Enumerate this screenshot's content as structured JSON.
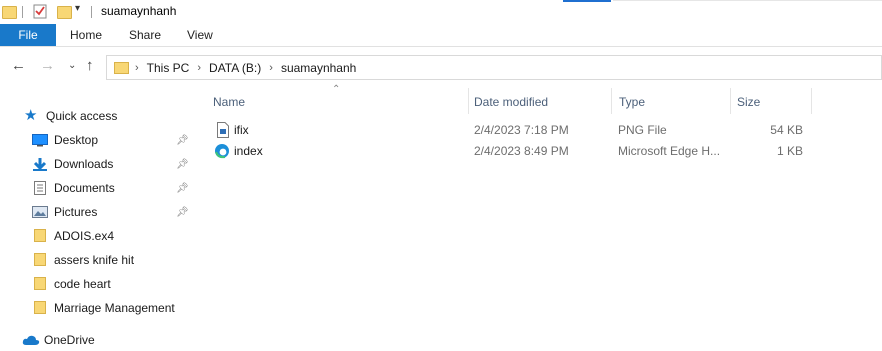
{
  "window": {
    "title": "suamaynhanh"
  },
  "ribbon": {
    "file": "File",
    "tabs": [
      "Home",
      "Share",
      "View"
    ]
  },
  "address": {
    "crumbs": [
      "This PC",
      "DATA (B:)",
      "suamaynhanh"
    ]
  },
  "nav": {
    "quick_access": "Quick access",
    "pinned": [
      {
        "label": "Desktop",
        "icon": "desktop-icon"
      },
      {
        "label": "Downloads",
        "icon": "downloads-icon"
      },
      {
        "label": "Documents",
        "icon": "documents-icon"
      },
      {
        "label": "Pictures",
        "icon": "pictures-icon"
      }
    ],
    "folders": [
      "ADOIS.ex4",
      "assers knife hit",
      "code heart",
      "Marriage Management"
    ],
    "onedrive": "OneDrive"
  },
  "columns": {
    "name": "Name",
    "date": "Date modified",
    "type": "Type",
    "size": "Size"
  },
  "files": [
    {
      "name": "ifix",
      "date": "2/4/2023 7:18 PM",
      "type": "PNG File",
      "size": "54 KB",
      "icon": "png-file-icon"
    },
    {
      "name": "index",
      "date": "2/4/2023 8:49 PM",
      "type": "Microsoft Edge H...",
      "size": "1 KB",
      "icon": "edge-icon"
    }
  ],
  "colors": {
    "accent": "#1979ca",
    "folder": "#f8d775",
    "header_text": "#4c607a"
  }
}
